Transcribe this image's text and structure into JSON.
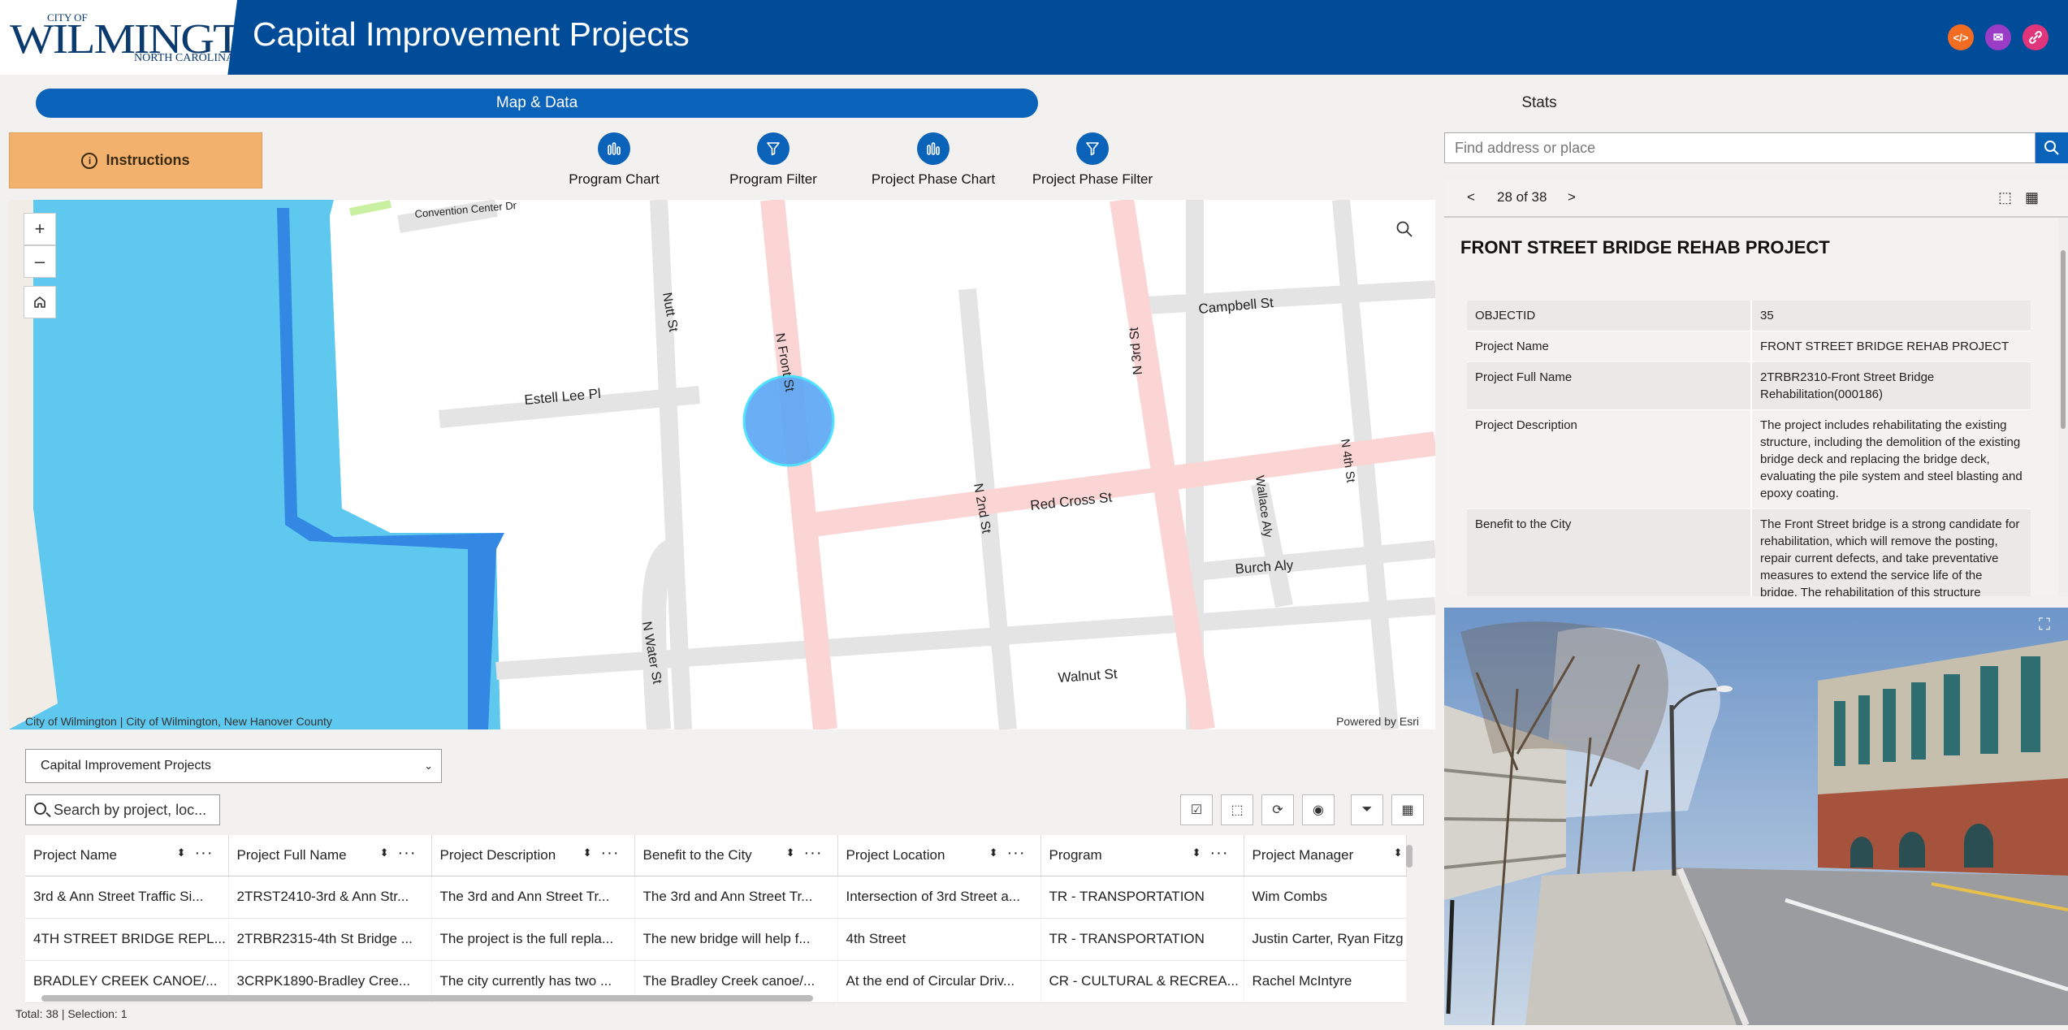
{
  "header": {
    "logo_city": "CITY OF",
    "logo_name": "WILMINGTON",
    "logo_state": "NORTH CAROLINA",
    "title": "Capital Improvement Projects",
    "buttons": [
      {
        "name": "embed-code-icon",
        "glyph": "</>",
        "color": "#f26d21"
      },
      {
        "name": "email-icon",
        "glyph": "✉",
        "color": "#9b3cc7"
      },
      {
        "name": "share-link-icon",
        "glyph": "🔗",
        "color": "#e0357a"
      }
    ]
  },
  "tabs": {
    "active": "Map & Data",
    "stats": "Stats"
  },
  "toolbar": {
    "instructions": "Instructions",
    "program_chart": "Program Chart",
    "program_filter": "Program Filter",
    "phase_chart": "Project Phase Chart",
    "phase_filter": "Project Phase Filter"
  },
  "map": {
    "streets": {
      "convention": "Convention Center Dr",
      "nutt": "Nutt St",
      "front": "N Front St",
      "third": "N 3rd St",
      "campbell": "Campbell St",
      "estell": "Estell Lee Pl",
      "red_cross": "Red Cross St",
      "second": "N 2nd St",
      "wallace": "Wallace Aly",
      "fourth": "N 4th St",
      "burch": "Burch Aly",
      "water": "N Water St",
      "walnut": "Walnut St"
    },
    "attribution": "City of Wilmington | City of Wilmington, New Hanover County",
    "powered": "Powered by Esri",
    "zoom_in": "+",
    "zoom_out": "–"
  },
  "table": {
    "layer_select": "Capital Improvement Projects",
    "search_placeholder": "Search by project, loc...",
    "columns": [
      "Project Name",
      "Project Full Name",
      "Project Description",
      "Benefit to the City",
      "Project Location",
      "Program",
      "Project Manager"
    ],
    "rows": [
      [
        "3rd & Ann Street Traffic Si...",
        "2TRST2410-3rd & Ann Str...",
        "The 3rd and Ann Street Tr...",
        "The 3rd and Ann Street Tr...",
        "Intersection of 3rd Street a...",
        "TR - TRANSPORTATION",
        "Wim Combs"
      ],
      [
        "4TH STREET BRIDGE REPL...",
        "2TRBR2315-4th St Bridge ...",
        "The project is the full repla...",
        "The new bridge will help f...",
        "4th Street",
        "TR - TRANSPORTATION",
        "Justin Carter, Ryan Fitzg"
      ],
      [
        "BRADLEY CREEK CANOE/...",
        "3CRPK1890-Bradley Cree...",
        "The city currently has two ...",
        "The Bradley Creek canoe/...",
        "At the end of Circular Driv...",
        "CR - CULTURAL & RECREA...",
        "Rachel McIntyre"
      ]
    ],
    "footer": "Total: 38 | Selection: 1"
  },
  "search": {
    "placeholder": "Find address or place"
  },
  "popup": {
    "prev": "<",
    "counter": "28 of 38",
    "next": ">",
    "title": "FRONT STREET BRIDGE REHAB PROJECT",
    "fields": [
      {
        "key": "OBJECTID",
        "value": "35"
      },
      {
        "key": "Project Name",
        "value": "FRONT STREET BRIDGE REHAB PROJECT"
      },
      {
        "key": "Project Full Name",
        "value": "2TRBR2310-Front Street Bridge Rehabilitation(000186)"
      },
      {
        "key": "Project Description",
        "value": "The project includes rehabilitating the existing structure, including the demolition of the existing bridge deck and replacing the bridge deck, evaluating the pile system and steel blasting and epoxy coating."
      },
      {
        "key": "Benefit to the City",
        "value": "The Front Street bridge is a strong candidate for rehabilitation, which will remove the posting, repair current defects, and take preventative measures to extend the service life of the bridge. The rehabilitation of this structure"
      }
    ]
  },
  "colors": {
    "header": "#004c99",
    "accent": "#0a63b8",
    "instructions": "#f2b26e",
    "water": "#5ec8ef",
    "road_major": "#f9d2d2"
  }
}
